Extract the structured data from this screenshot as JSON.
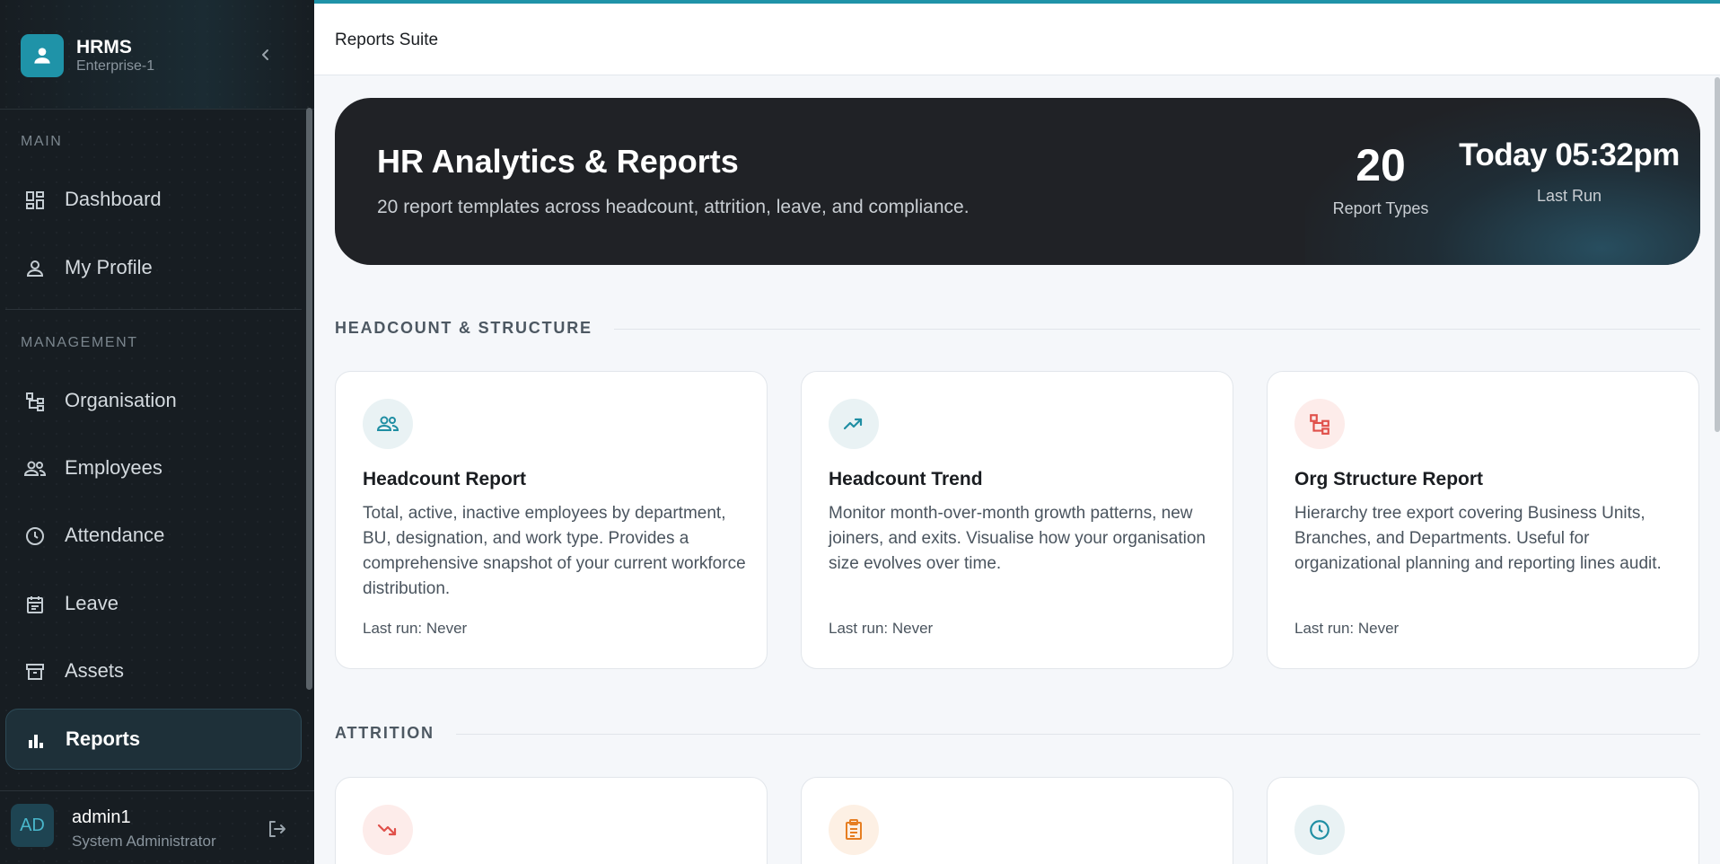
{
  "brand": {
    "name": "HRMS",
    "subtitle": "Enterprise-1",
    "logo_icon": "user-icon",
    "accent": "#1f93a8"
  },
  "sidebar": {
    "sections": [
      {
        "label": "MAIN"
      },
      {
        "label": "MANAGEMENT"
      }
    ],
    "items": [
      {
        "label": "Dashboard",
        "icon": "dashboard-icon"
      },
      {
        "label": "My Profile",
        "icon": "user-icon"
      },
      {
        "label": "Organisation",
        "icon": "org-tree-icon"
      },
      {
        "label": "Employees",
        "icon": "people-icon"
      },
      {
        "label": "Attendance",
        "icon": "clock-icon"
      },
      {
        "label": "Leave",
        "icon": "calendar-icon"
      },
      {
        "label": "Assets",
        "icon": "archive-icon"
      },
      {
        "label": "Reports",
        "icon": "bar-chart-icon",
        "active": true
      }
    ]
  },
  "user": {
    "initials": "AD",
    "name": "admin1",
    "role": "System Administrator"
  },
  "topbar": {
    "title": "Reports Suite"
  },
  "hero": {
    "title": "HR Analytics & Reports",
    "subtitle": "20 report templates across headcount, attrition, leave, and compliance.",
    "stat1_value": "20",
    "stat1_label": "Report Types",
    "stat2_value": "Today 05:32pm",
    "stat2_label": "Last Run"
  },
  "sections": [
    {
      "title": "HEADCOUNT & STRUCTURE",
      "cards": [
        {
          "title": "Headcount Report",
          "desc": "Total, active, inactive employees by department, BU, designation, and work type. Provides a comprehensive snapshot of your current workforce distribution.",
          "meta": "Last run: Never",
          "icon": "people-icon",
          "icon_color": "#1f8ea3",
          "icon_bg": "#e9f2f4"
        },
        {
          "title": "Headcount Trend",
          "desc": "Monitor month-over-month growth patterns, new joiners, and exits. Visualise how your organisation size evolves over time.",
          "meta": "Last run: Never",
          "icon": "trend-up-icon",
          "icon_color": "#1f8ea3",
          "icon_bg": "#e9f2f4"
        },
        {
          "title": "Org Structure Report",
          "desc": "Hierarchy tree export covering Business Units, Branches, and Departments. Useful for organizational planning and reporting lines audit.",
          "meta": "Last run: Never",
          "icon": "org-tree-icon",
          "icon_color": "#e0504a",
          "icon_bg": "#fdecea"
        }
      ]
    },
    {
      "title": "ATTRITION",
      "cards": [
        {
          "icon": "trend-down-icon",
          "icon_color": "#e0504a",
          "icon_bg": "#fdecea"
        },
        {
          "icon": "clipboard-icon",
          "icon_color": "#e67e22",
          "icon_bg": "#fdf0e4"
        },
        {
          "icon": "clock-icon",
          "icon_color": "#1f8ea3",
          "icon_bg": "#e9f2f4"
        }
      ]
    }
  ]
}
